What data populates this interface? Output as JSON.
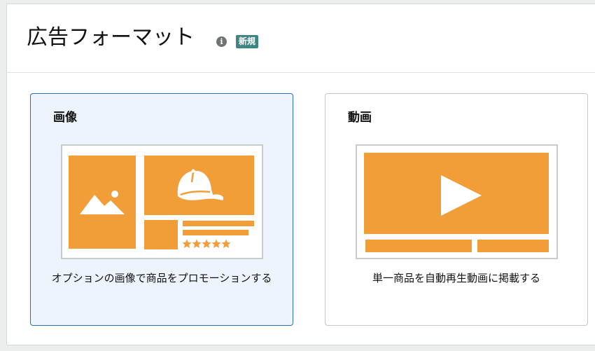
{
  "header": {
    "title": "広告フォーマット",
    "info_icon": "info-icon",
    "badge": "新規"
  },
  "cards": [
    {
      "id": "image",
      "title": "画像",
      "description": "オプションの画像で商品をプロモーションする",
      "selected": true,
      "illustration": "image-ad-illustration"
    },
    {
      "id": "video",
      "title": "動画",
      "description": "単一商品を自動再生動画に掲載する",
      "selected": false,
      "illustration": "video-ad-illustration"
    }
  ],
  "colors": {
    "accent_orange": "#f19e38",
    "selected_border": "#2c6fb5",
    "selected_bg": "#edf4fd",
    "badge_bg": "#3f8583"
  }
}
